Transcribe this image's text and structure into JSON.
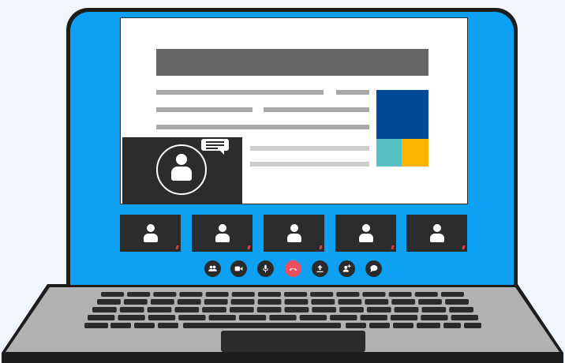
{
  "colors": {
    "screen_bezel": "#0ea0f2",
    "lid_outline": "#1d1d1d",
    "doc_header": "#666666",
    "doc_bar": "#a9a9a9",
    "doc_bar_light": "#cdcdcd",
    "block_dark_blue": "#004a97",
    "block_teal": "#55bfc4",
    "block_yellow": "#fcb400",
    "video_tile": "#2c2c2c",
    "end_call": "#ef4f5d",
    "keyboard_deck": "#b2b2b2",
    "key": "#2b2b2b"
  },
  "participants": [
    {
      "icon": "person-icon",
      "mic_state": "muted"
    },
    {
      "icon": "person-icon",
      "mic_state": "muted"
    },
    {
      "icon": "person-icon",
      "mic_state": "muted"
    },
    {
      "icon": "person-icon",
      "mic_state": "muted"
    },
    {
      "icon": "person-icon",
      "mic_state": "muted"
    }
  ],
  "controls": [
    {
      "name": "participants-button",
      "icon": "people-icon"
    },
    {
      "name": "camera-button",
      "icon": "video-camera-icon"
    },
    {
      "name": "microphone-button",
      "icon": "microphone-icon"
    },
    {
      "name": "end-call-button",
      "icon": "hang-up-icon"
    },
    {
      "name": "share-screen-button",
      "icon": "upload-icon"
    },
    {
      "name": "add-participant-button",
      "icon": "add-user-icon"
    },
    {
      "name": "chat-button",
      "icon": "chat-bubble-icon"
    }
  ]
}
